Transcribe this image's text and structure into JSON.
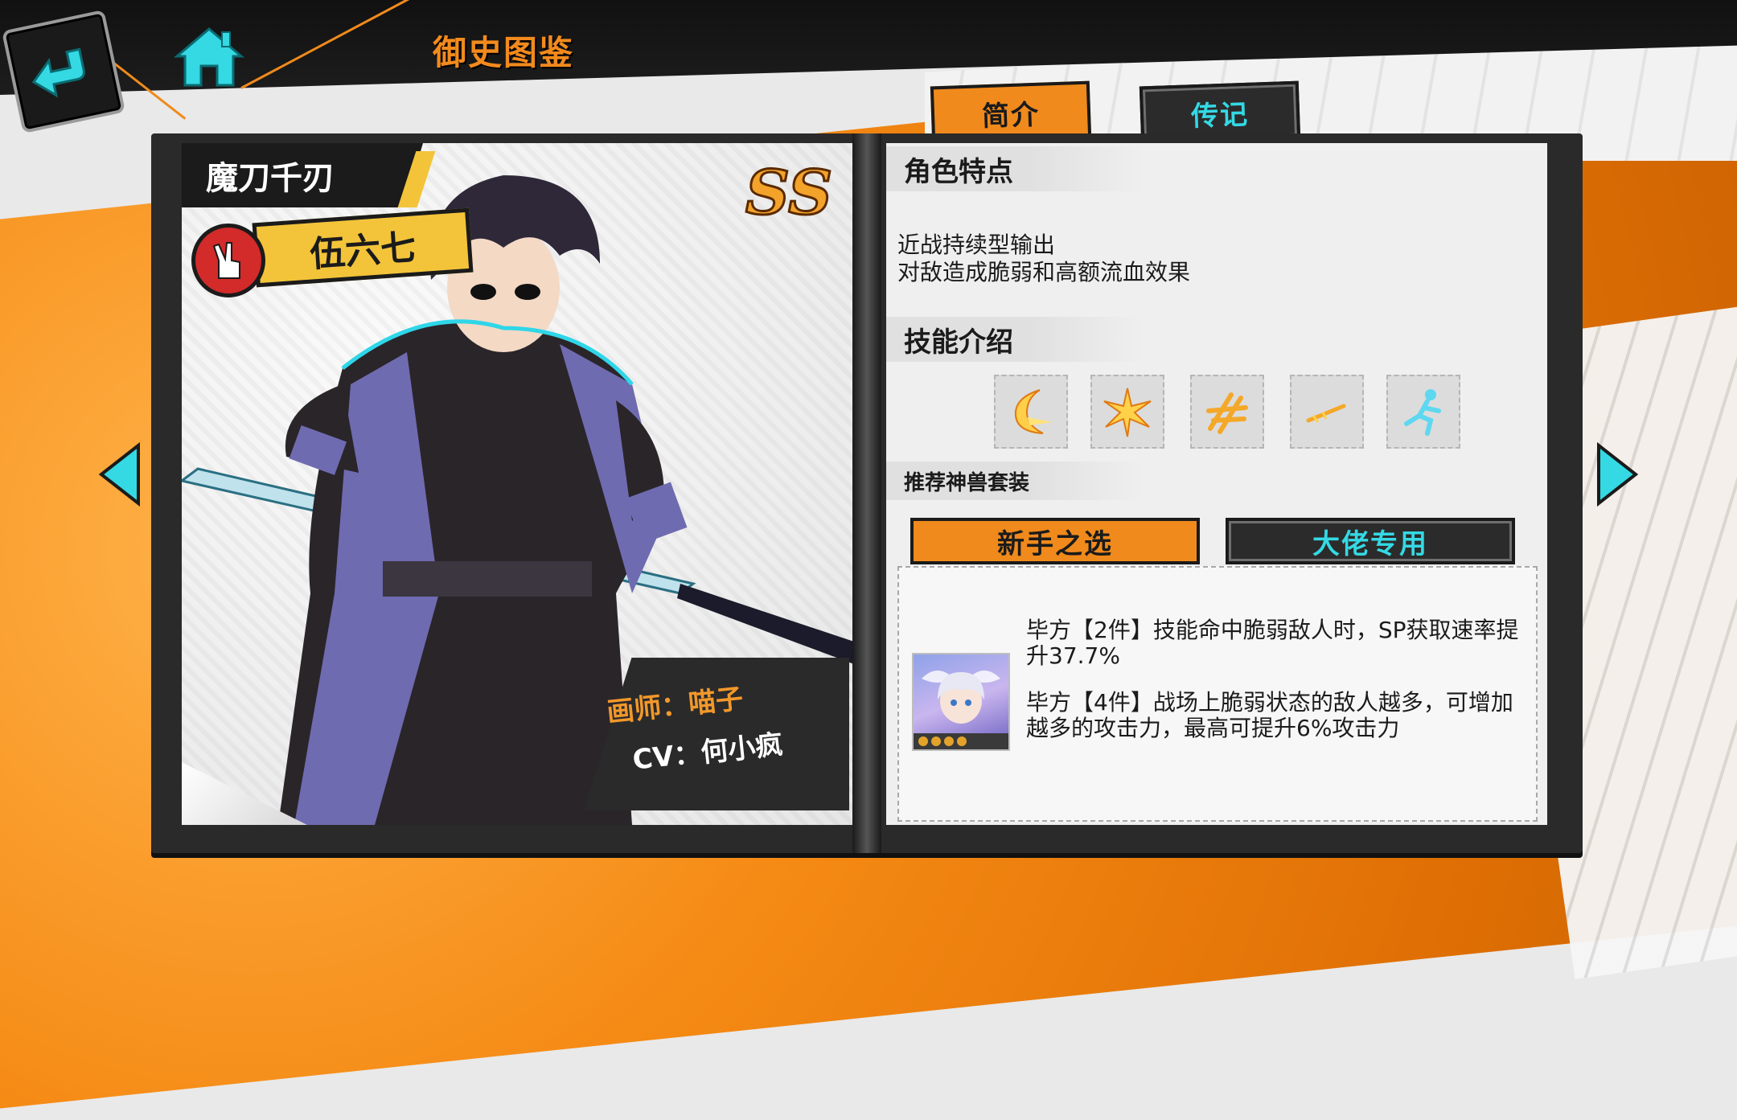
{
  "header": {
    "title": "御史图鉴"
  },
  "tabs": [
    {
      "label": "简介",
      "active": true
    },
    {
      "label": "传记",
      "active": false
    }
  ],
  "character": {
    "title": "魔刀千刃",
    "name": "伍六七",
    "rank": "SS",
    "artist_label": "画师：喵子",
    "cv_label": "CV：何小疯"
  },
  "features": {
    "heading": "角色特点",
    "lines": [
      "近战持续型输出",
      "对敌造成脆弱和高额流血效果"
    ]
  },
  "skills": {
    "heading": "技能介绍",
    "icons": [
      "crescent-slash-icon",
      "starburst-icon",
      "blade-flurry-icon",
      "dart-icon",
      "dash-icon"
    ]
  },
  "sets": {
    "heading": "推荐神兽套装",
    "tabs": [
      {
        "label": "新手之选",
        "active": true
      },
      {
        "label": "大佬专用",
        "active": false
      }
    ],
    "effects": [
      "毕方【2件】技能命中脆弱敌人时，SP获取速率提升37.7%",
      "毕方【4件】战场上脆弱状态的敌人越多，可增加越多的攻击力，最高可提升6%攻击力"
    ]
  },
  "colors": {
    "accent_orange": "#f08a1c",
    "accent_cyan": "#34d9e4",
    "dark": "#1b1b1b",
    "yellow": "#f3c43a"
  }
}
